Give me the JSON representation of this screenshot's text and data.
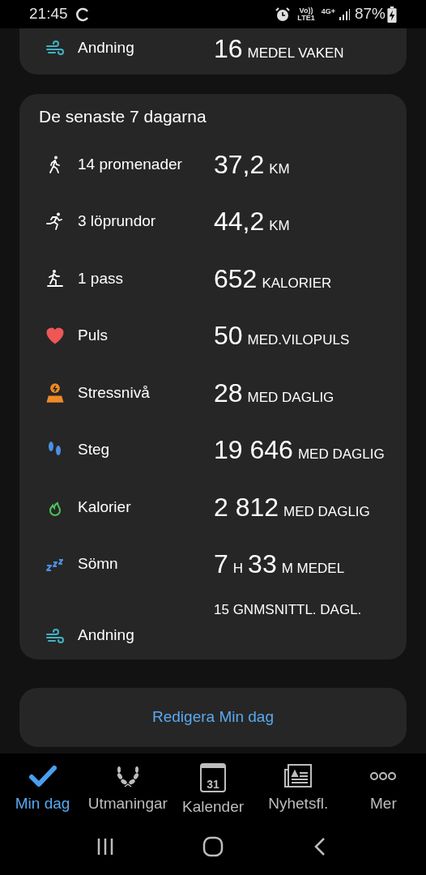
{
  "status_bar": {
    "time": "21:45",
    "volte": "Vo))",
    "lte": "LTE1",
    "network": "4G+",
    "battery": "87%"
  },
  "top_card": {
    "rows": [
      {
        "kind": "wind",
        "label": "Andning",
        "value": [
          {
            "kind": "number",
            "text": "16"
          },
          {
            "kind": "unit",
            "text": "MEDEL VAKEN"
          }
        ]
      }
    ]
  },
  "summary_card": {
    "title": "De senaste 7 dagarna",
    "rows": [
      {
        "kind": "walk",
        "label": "14 promenader",
        "value": [
          {
            "kind": "number",
            "text": "37,2"
          },
          {
            "kind": "unit",
            "text": "KM"
          }
        ]
      },
      {
        "kind": "run",
        "label": "3 löprundor",
        "value": [
          {
            "kind": "number",
            "text": "44,2"
          },
          {
            "kind": "unit",
            "text": "KM"
          }
        ]
      },
      {
        "kind": "treadmill",
        "label": "1 pass",
        "value": [
          {
            "kind": "number",
            "text": "652"
          },
          {
            "kind": "unit",
            "text": "KALORIER"
          }
        ]
      },
      {
        "kind": "heart",
        "label": "Puls",
        "value": [
          {
            "kind": "number",
            "text": "50"
          },
          {
            "kind": "unit",
            "text": "MED.VILOPULS"
          }
        ]
      },
      {
        "kind": "stress",
        "label": "Stressnivå",
        "value": [
          {
            "kind": "number",
            "text": "28"
          },
          {
            "kind": "unit",
            "text": "MED DAGLIG"
          }
        ]
      },
      {
        "kind": "steps",
        "label": "Steg",
        "value": [
          {
            "kind": "number",
            "text": "19 646"
          },
          {
            "kind": "unit",
            "text": "MED DAGLIG"
          }
        ]
      },
      {
        "kind": "flame",
        "label": "Kalorier",
        "value": [
          {
            "kind": "number",
            "text": "2 812"
          },
          {
            "kind": "unit",
            "text": "MED DAGLIG"
          }
        ]
      },
      {
        "kind": "sleep",
        "label": "Sömn",
        "value": [
          {
            "kind": "number",
            "text": "7"
          },
          {
            "kind": "unit",
            "text": "H"
          },
          {
            "kind": "number",
            "text": "33"
          },
          {
            "kind": "unit",
            "text": "M MEDEL"
          }
        ]
      },
      {
        "kind": "breath",
        "label": "Andning",
        "value": [
          {
            "kind": "unit",
            "text": "15 GNMSNITTL. DAGL."
          }
        ]
      }
    ]
  },
  "edit_button": "Redigera Min dag",
  "bottom_nav": [
    {
      "kind": "check",
      "label": "Min dag",
      "selected": true
    },
    {
      "kind": "laurel",
      "label": "Utmaningar",
      "selected": false
    },
    {
      "kind": "calendar",
      "label": "Kalender",
      "icon_text": "31",
      "selected": false
    },
    {
      "kind": "news",
      "label": "Nyhetsfl.",
      "selected": false
    },
    {
      "kind": "more",
      "label": "Mer",
      "selected": false
    }
  ]
}
